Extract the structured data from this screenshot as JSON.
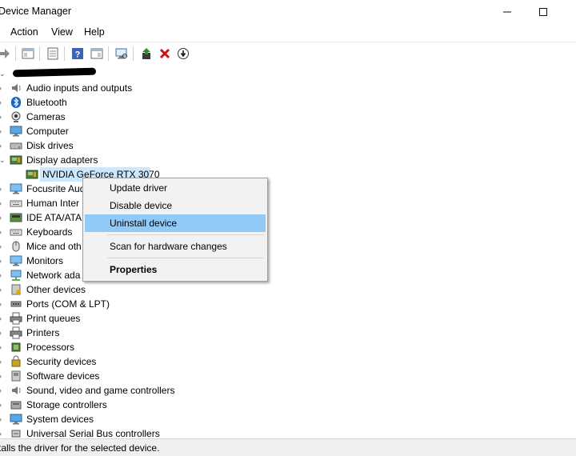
{
  "window": {
    "title": "Device Manager"
  },
  "menubar": {
    "items": [
      "Action",
      "View",
      "Help"
    ]
  },
  "toolbar": {
    "buttons": [
      "forward-icon",
      "show-hide-console-tree-icon",
      "properties-icon",
      "help-icon",
      "action-pane-icon",
      "scan-hardware-icon",
      "update-driver-icon",
      "uninstall-icon",
      "disable-device-icon"
    ],
    "colors": {
      "uninstall": "#cc1111",
      "update": "#2e8b2e"
    }
  },
  "tree": {
    "root": "",
    "items": [
      {
        "label": "Audio inputs and outputs",
        "icon": "speaker-icon"
      },
      {
        "label": "Bluetooth",
        "icon": "bluetooth-icon"
      },
      {
        "label": "Cameras",
        "icon": "camera-icon"
      },
      {
        "label": "Computer",
        "icon": "computer-icon"
      },
      {
        "label": "Disk drives",
        "icon": "disk-drive-icon"
      },
      {
        "label": "Display adapters",
        "icon": "display-adapter-icon",
        "expanded": true
      },
      {
        "label": "NVIDIA GeForce RTX 3070",
        "icon": "display-adapter-icon",
        "child": true,
        "selected": true
      },
      {
        "label": "Focusrite Aud",
        "icon": "monitor-icon"
      },
      {
        "label": "Human Inter",
        "icon": "keyboard-icon"
      },
      {
        "label": "IDE ATA/ATAP",
        "icon": "ide-controller-icon"
      },
      {
        "label": "Keyboards",
        "icon": "keyboard-icon"
      },
      {
        "label": "Mice and oth",
        "icon": "mouse-icon"
      },
      {
        "label": "Monitors",
        "icon": "monitor-icon"
      },
      {
        "label": "Network ada",
        "icon": "network-icon"
      },
      {
        "label": "Other devices",
        "icon": "unknown-device-icon"
      },
      {
        "label": "Ports (COM & LPT)",
        "icon": "port-icon"
      },
      {
        "label": "Print queues",
        "icon": "printer-icon"
      },
      {
        "label": "Printers",
        "icon": "printer-icon"
      },
      {
        "label": "Processors",
        "icon": "processor-icon"
      },
      {
        "label": "Security devices",
        "icon": "security-icon"
      },
      {
        "label": "Software devices",
        "icon": "software-device-icon"
      },
      {
        "label": "Sound, video and game controllers",
        "icon": "speaker-icon"
      },
      {
        "label": "Storage controllers",
        "icon": "storage-icon"
      },
      {
        "label": "System devices",
        "icon": "computer-icon"
      },
      {
        "label": "Universal Serial Bus controllers",
        "icon": "usb-icon"
      }
    ]
  },
  "context_menu": {
    "items": [
      {
        "label": "Update driver"
      },
      {
        "label": "Disable device"
      },
      {
        "label": "Uninstall device",
        "highlighted": true
      },
      {
        "label": "Scan for hardware changes"
      },
      {
        "label": "Properties",
        "bold": true
      }
    ]
  },
  "statusbar": {
    "text": "talls the driver for the selected device."
  }
}
